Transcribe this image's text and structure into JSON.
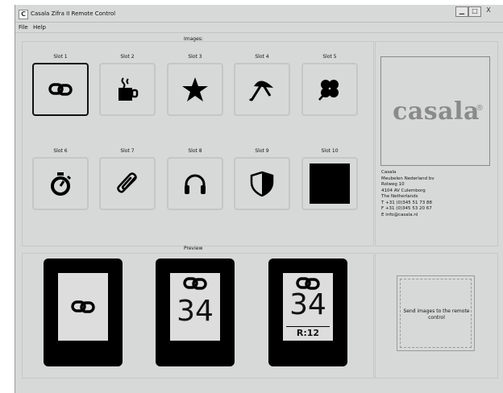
{
  "window": {
    "title": "Casala Zifra II Remote Control",
    "app_icon_letter": "C",
    "minimize_glyph": "▁",
    "maximize_glyph": "□",
    "close_glyph": "X"
  },
  "menu": [
    "File",
    "Help"
  ],
  "images_section": {
    "title": "Images:",
    "slots": [
      {
        "label": "Slot 1",
        "icon": "link-icon",
        "selected": true
      },
      {
        "label": "Slot 2",
        "icon": "coffee-cup-icon",
        "selected": false
      },
      {
        "label": "Slot 3",
        "icon": "star-icon",
        "selected": false
      },
      {
        "label": "Slot 4",
        "icon": "umbrella-icon",
        "selected": false
      },
      {
        "label": "Slot 5",
        "icon": "clover-icon",
        "selected": false
      },
      {
        "label": "Slot 6",
        "icon": "stopwatch-icon",
        "selected": false
      },
      {
        "label": "Slot 7",
        "icon": "paperclip-icon",
        "selected": false
      },
      {
        "label": "Slot 8",
        "icon": "headphones-icon",
        "selected": false
      },
      {
        "label": "Slot 9",
        "icon": "shield-icon",
        "selected": false
      },
      {
        "label": "Slot 10",
        "icon": "black-square-icon",
        "selected": false
      }
    ]
  },
  "company": {
    "logo_text": "casala",
    "logo_mark": "®",
    "address_lines": [
      "Casala",
      "Meubelen Nederland bv",
      "Rolweg 10",
      "4104 AV Culemborg",
      "The Netherlands",
      "T +31 (0)345 51 73 88",
      "F +31 (0)345 53 20 67",
      "E info@casala.nl"
    ]
  },
  "preview": {
    "title": "Preview",
    "devices": [
      {
        "icon": "link-icon"
      },
      {
        "icon": "link-icon",
        "number": "34"
      },
      {
        "icon": "link-icon",
        "number": "34",
        "room": "R:12"
      }
    ]
  },
  "send_button": {
    "label": "Send images to the remote control"
  },
  "colors": {
    "window_bg": "#d7d9d8",
    "border": "#c6c8c7",
    "logo_gray": "#8a8a8a"
  }
}
